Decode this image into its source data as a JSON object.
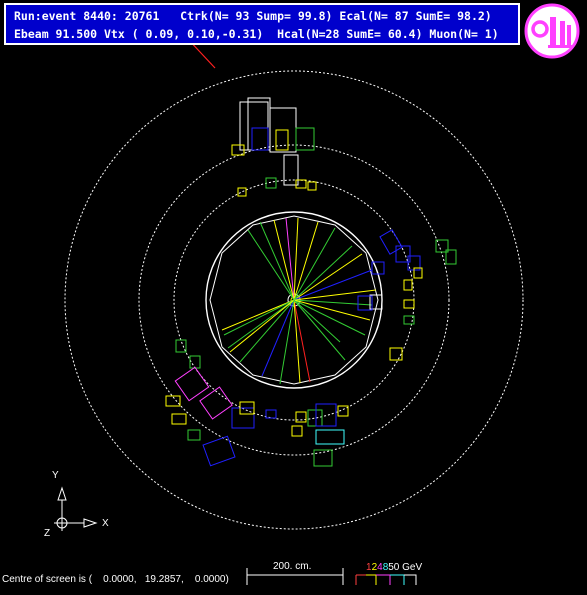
{
  "header": {
    "line1": "Run:event 8440: 20761   Ctrk(N= 93 Sump= 99.8) Ecal(N= 87 SumE= 98.2)",
    "line2": "Ebeam 91.500 Vtx ( 0.09, 0.10,-0.31)  Hcal(N=28 SumE= 60.4) Muon(N= 1)"
  },
  "logo": {
    "text": "OPAL"
  },
  "axes": {
    "y_label": "Y",
    "x_label": "X",
    "z_label": "Z"
  },
  "scale": {
    "label": "200. cm."
  },
  "energy_scale": {
    "parts": [
      "1",
      "2",
      "4",
      "8",
      "50 GeV"
    ],
    "colors": [
      "#ff4040",
      "#ffff00",
      "#ff40ff",
      "#40ffff",
      "#ffffff"
    ]
  },
  "footer": {
    "centre_text": "Centre of screen is (    0.0000,   19.2857,    0.0000)"
  },
  "colors": {
    "header_bg": "#0000cc",
    "tracks_yellow": "#ffff00",
    "tracks_green": "#33cc33",
    "ecal_blue": "#2020ff",
    "hcal_white": "#ffffff",
    "muon_red": "#ff2020"
  }
}
